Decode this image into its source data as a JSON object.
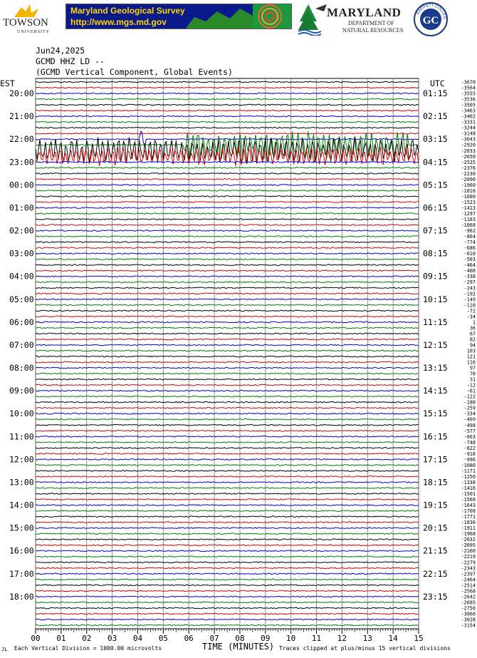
{
  "header": {
    "towson_name": "TOWSON",
    "towson_sub": "UNIVERSITY",
    "mgs_title": "Maryland Geological Survey",
    "mgs_url": "http://www.mgs.md.gov",
    "dnr_title": "MARYLAND",
    "dnr_line1": "DEPARTMENT OF",
    "dnr_line2": "NATURAL RESOURCES",
    "garrett_text": "GARRETT COLLEGE",
    "garrett_mark": "GC"
  },
  "chart_data": {
    "type": "line",
    "title_date": "Jun24,2025",
    "title_station": "GCMD HHZ LD --",
    "title_desc": "(GCMD Vertical Component, Global Events)",
    "left_axis_label": "EST",
    "right_axis_label": "UTC",
    "xlabel": "TIME (MINUTES)",
    "x_ticks": [
      "00",
      "01",
      "02",
      "03",
      "04",
      "05",
      "06",
      "07",
      "08",
      "09",
      "10",
      "11",
      "12",
      "13",
      "14",
      "15"
    ],
    "xlim": [
      0,
      15
    ],
    "est_labels": [
      "20:00",
      "21:00",
      "22:00",
      "23:00",
      "00:00",
      "01:00",
      "02:00",
      "03:00",
      "04:00",
      "05:00",
      "06:00",
      "07:00",
      "08:00",
      "09:00",
      "10:00",
      "11:00",
      "12:00",
      "13:00",
      "14:00",
      "15:00",
      "16:00",
      "17:00",
      "18:00"
    ],
    "utc_labels": [
      "01:15",
      "02:15",
      "03:15",
      "04:15",
      "05:15",
      "06:15",
      "07:15",
      "08:15",
      "09:15",
      "10:15",
      "11:15",
      "12:15",
      "13:15",
      "14:15",
      "15:15",
      "16:15",
      "17:15",
      "18:15",
      "19:15",
      "20:15",
      "21:15",
      "22:15",
      "23:15"
    ],
    "trace_offsets": [
      "-3670",
      "-3564",
      "-3555",
      "-3536",
      "-3505",
      "-3463",
      "-3402",
      "-3331",
      "-3244",
      "-3148",
      "-3043",
      "-2920",
      "-2833",
      "-2650",
      "-2525",
      "-2376",
      "-2230",
      "-2090",
      "-1960",
      "-1816",
      "-1680",
      "-1523",
      "-1413",
      "-1297",
      "-1183",
      "-1068",
      "-962",
      "-864",
      "-774",
      "-686",
      "-610",
      "-503",
      "-464",
      "-408",
      "-338",
      "-297",
      "-243",
      "-192",
      "-149",
      "-110",
      "-72",
      "-34",
      "1",
      "36",
      "67",
      "82",
      "94",
      "103",
      "121",
      "116",
      "97",
      "70",
      "31",
      "-12",
      "-61",
      "-122",
      "-180",
      "-259",
      "-334",
      "-409",
      "-498",
      "-577",
      "-663",
      "-748",
      "-822",
      "-910",
      "-996",
      "-1080",
      "-1171",
      "-1250",
      "-1338",
      "-1416",
      "-1501",
      "-1568",
      "-1643",
      "-1708",
      "-1771",
      "-1836",
      "-1911",
      "-1968",
      "-2032",
      "-2095",
      "-2160",
      "-2219",
      "-2279",
      "-2343",
      "-2397",
      "-2464",
      "-2514",
      "-2568",
      "-2642",
      "-2685",
      "-2750",
      "-3060",
      "-3028",
      "-3154"
    ],
    "trace_colors": [
      "#000000",
      "#e00000",
      "#0000e0",
      "#008000"
    ],
    "events": [
      {
        "row": 10,
        "start": 4.1,
        "end": 4.3,
        "amp": 1.0
      },
      {
        "row": 11,
        "start": 5.8,
        "end": 14.6,
        "amp": 1.4
      },
      {
        "row": 12,
        "start": 0.0,
        "end": 15.0,
        "amp": 1.3
      },
      {
        "row": 13,
        "start": 0.0,
        "end": 15.0,
        "amp": 0.9
      }
    ],
    "footer_left": "Each Vertical Division = 1000.00 microvolts",
    "footer_right": "Traces clipped at plus/minus 15 vertical divisions",
    "corner_mark": "JL"
  }
}
